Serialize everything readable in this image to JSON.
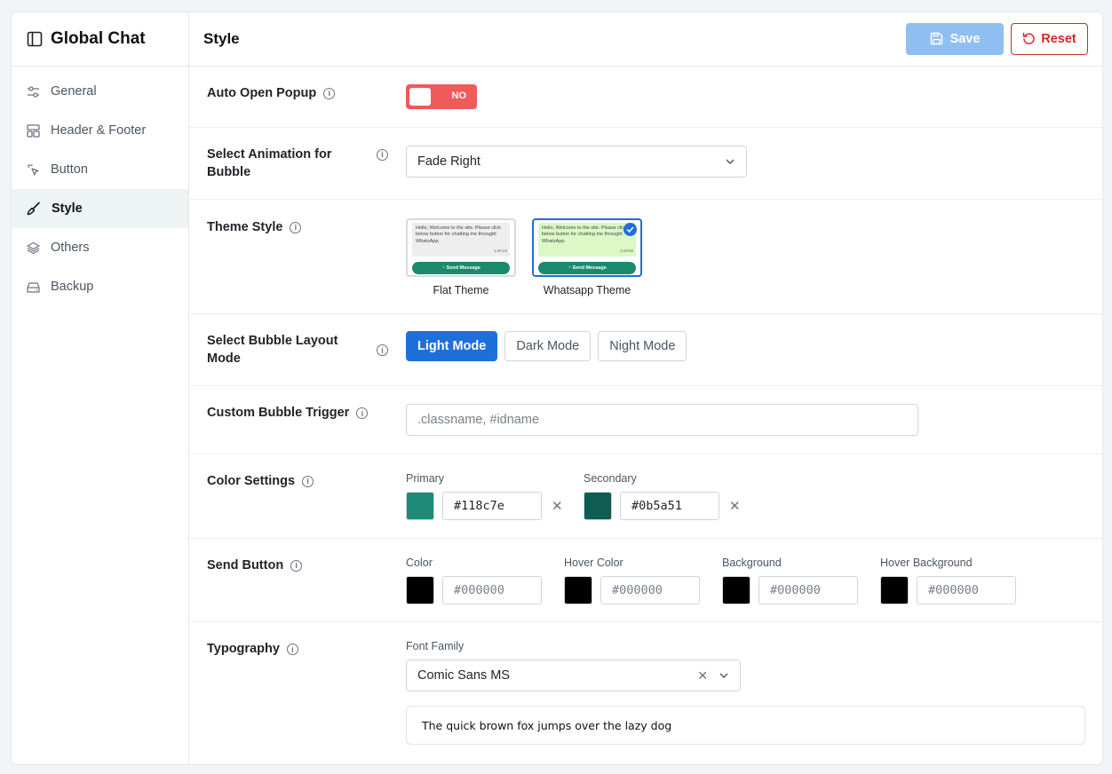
{
  "app": {
    "title": "Global Chat"
  },
  "sidebar": {
    "items": [
      {
        "label": "General",
        "icon": "sliders-icon"
      },
      {
        "label": "Header & Footer",
        "icon": "layout-icon"
      },
      {
        "label": "Button",
        "icon": "pointer-click-icon"
      },
      {
        "label": "Style",
        "icon": "brush-icon",
        "active": true
      },
      {
        "label": "Others",
        "icon": "layers-icon"
      },
      {
        "label": "Backup",
        "icon": "drive-icon"
      }
    ]
  },
  "header": {
    "title": "Style",
    "save_label": "Save",
    "reset_label": "Reset"
  },
  "form": {
    "auto_open": {
      "label": "Auto Open Popup",
      "value": "NO"
    },
    "animation": {
      "label": "Select Animation for Bubble",
      "value": "Fade Right"
    },
    "theme_style": {
      "label": "Theme Style",
      "preview_message": "Hello, Welcome to the site. Please click below button for chatting me throught WhatsApp.",
      "preview_time": "1:29:24",
      "preview_time_2": "1:29:56",
      "send_label": "Send Message",
      "themes": [
        {
          "name": "Flat Theme"
        },
        {
          "name": "Whatsapp Theme",
          "selected": true
        }
      ]
    },
    "bubble_layout": {
      "label": "Select Bubble Layout Mode",
      "options": [
        "Light Mode",
        "Dark Mode",
        "Night Mode"
      ],
      "selected": "Light Mode"
    },
    "custom_trigger": {
      "label": "Custom Bubble Trigger",
      "placeholder": ".classname, #idname"
    },
    "color_settings": {
      "label": "Color Settings",
      "primary": {
        "label": "Primary",
        "value": "#118c7e"
      },
      "secondary": {
        "label": "Secondary",
        "value": "#0b5a51"
      }
    },
    "send_button": {
      "label": "Send Button",
      "color": {
        "label": "Color",
        "value": "#000000"
      },
      "hover_color": {
        "label": "Hover Color",
        "value": "#000000"
      },
      "background": {
        "label": "Background",
        "value": "#000000"
      },
      "hover_background": {
        "label": "Hover Background",
        "value": "#000000"
      }
    },
    "typography": {
      "label": "Typography",
      "font_family_label": "Font Family",
      "font_family": "Comic Sans MS",
      "preview_text": "The quick brown fox jumps over the lazy dog"
    }
  },
  "colors": {
    "accent": "#1e6fd9",
    "danger": "#d22a2a",
    "toggle_off": "#ef5a5a",
    "whatsapp_green": "#1b8a6c"
  }
}
